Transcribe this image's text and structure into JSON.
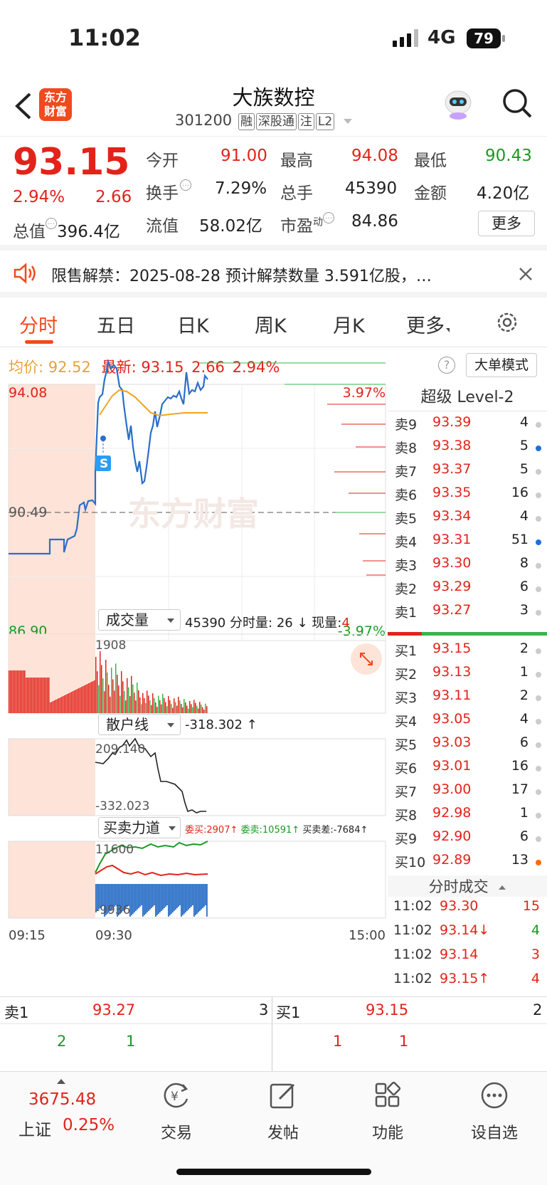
{
  "status": {
    "time": "11:02",
    "network": "4G",
    "battery": "79"
  },
  "header": {
    "logo_line1": "东方",
    "logo_line2": "财富",
    "title": "大族数控",
    "code": "301200",
    "tags": [
      "融",
      "深股通",
      "注",
      "L2"
    ]
  },
  "quote": {
    "price": "93.15",
    "change_pct": "2.94%",
    "change": "2.66",
    "open_label": "今开",
    "open": "91.00",
    "high_label": "最高",
    "high": "94.08",
    "low_label": "最低",
    "low": "90.43",
    "turnover_label": "换手",
    "turnover": "7.29%",
    "volume_label": "总手",
    "volume": "45390",
    "amount_label": "金额",
    "amount": "4.20亿",
    "mcap_label": "总值",
    "mcap": "396.4亿",
    "float_label": "流值",
    "float": "58.02亿",
    "pe_label": "市盈",
    "pe_super": "动",
    "pe": "84.86",
    "more": "更多"
  },
  "notice": {
    "text": "限售解禁：2025-08-28 预计解禁数量 3.591亿股，…"
  },
  "tabs": [
    {
      "label": "分时"
    },
    {
      "label": "五日"
    },
    {
      "label": "日K"
    },
    {
      "label": "周K"
    },
    {
      "label": "月K"
    },
    {
      "label": "更多"
    }
  ],
  "intraday": {
    "avg_label": "均价:",
    "avg": "92.52",
    "last_label": "最新:",
    "last": "93.15",
    "chg": "2.66",
    "pct": "2.94%",
    "mode_button": "大单模式",
    "y_max": "94.08",
    "y_mid": "90.49",
    "y_min": "86.90",
    "pct_max": "3.97%",
    "pct_min": "-3.97%",
    "s_marker": "S",
    "watermark": "东方财富"
  },
  "volume": {
    "label": "成交量",
    "total": "45390",
    "minute_label": "分时量:",
    "minute": "26",
    "minute_arrow": "↓",
    "now_label": "现量:",
    "now": "4",
    "ymax": "1908"
  },
  "retail": {
    "label": "散户线",
    "value": "-318.302",
    "arrow": "↑",
    "ymax": "209.140",
    "ymin": "-332.023"
  },
  "power": {
    "label": "买卖力道",
    "buy_label": "委买:2907",
    "buy_arrow": "↑",
    "sell_label": "委卖:10591",
    "sell_arrow": "↑",
    "diff_label": "买卖差:-7684",
    "diff_arrow": "↑",
    "ymax": "11600",
    "ymin": "-9936"
  },
  "time_axis": [
    "09:15",
    "09:30",
    "15:00"
  ],
  "book": {
    "title": "超级 Level-2",
    "asks": [
      {
        "l": "卖9",
        "p": "93.39",
        "v": "4",
        "dot": "#ccc"
      },
      {
        "l": "卖8",
        "p": "93.38",
        "v": "5",
        "dot": "#1f6fd6"
      },
      {
        "l": "卖7",
        "p": "93.37",
        "v": "5",
        "dot": "#ccc"
      },
      {
        "l": "卖6",
        "p": "93.35",
        "v": "16",
        "dot": "#ccc"
      },
      {
        "l": "卖5",
        "p": "93.34",
        "v": "4",
        "dot": "#ccc"
      },
      {
        "l": "卖4",
        "p": "93.31",
        "v": "51",
        "dot": "#1f6fd6"
      },
      {
        "l": "卖3",
        "p": "93.30",
        "v": "8",
        "dot": "#ccc"
      },
      {
        "l": "卖2",
        "p": "93.29",
        "v": "6",
        "dot": "#ccc"
      },
      {
        "l": "卖1",
        "p": "93.27",
        "v": "3",
        "dot": "#ccc"
      }
    ],
    "bids": [
      {
        "l": "买1",
        "p": "93.15",
        "v": "2",
        "dot": "#ccc"
      },
      {
        "l": "买2",
        "p": "93.13",
        "v": "1",
        "dot": "#ccc"
      },
      {
        "l": "买3",
        "p": "93.11",
        "v": "2",
        "dot": "#ccc"
      },
      {
        "l": "买4",
        "p": "93.05",
        "v": "4",
        "dot": "#ccc"
      },
      {
        "l": "买5",
        "p": "93.03",
        "v": "6",
        "dot": "#ccc"
      },
      {
        "l": "买6",
        "p": "93.01",
        "v": "16",
        "dot": "#ccc"
      },
      {
        "l": "买7",
        "p": "93.00",
        "v": "17",
        "dot": "#ccc"
      },
      {
        "l": "买8",
        "p": "92.98",
        "v": "1",
        "dot": "#ccc"
      },
      {
        "l": "买9",
        "p": "92.90",
        "v": "6",
        "dot": "#ccc"
      },
      {
        "l": "买10",
        "p": "92.89",
        "v": "13",
        "dot": "#ff6a00"
      }
    ],
    "ticks_title": "分时成交",
    "ticks": [
      {
        "t": "11:02",
        "p": "93.30",
        "v": "15",
        "color": "#e2231a",
        "vcolor": "#e2231a"
      },
      {
        "t": "11:02",
        "p": "93.14↓",
        "v": "4",
        "color": "#e2231a",
        "vcolor": "#1a9a23"
      },
      {
        "t": "11:02",
        "p": "93.14",
        "v": "3",
        "color": "#e2231a",
        "vcolor": "#e2231a"
      },
      {
        "t": "11:02",
        "p": "93.15↑",
        "v": "4",
        "color": "#e2231a",
        "vcolor": "#e2231a"
      }
    ]
  },
  "l2row": {
    "sell_label": "卖1",
    "sell_price": "93.27",
    "sell_total": "3",
    "sell_q": [
      "2",
      "1"
    ],
    "buy_label": "买1",
    "buy_price": "93.15",
    "buy_total": "2",
    "buy_q": [
      "1",
      "1"
    ]
  },
  "bottom": {
    "index_value": "3675.48",
    "index_name": "上证",
    "index_pct": "0.25%",
    "items": [
      "交易",
      "发帖",
      "功能",
      "设自选"
    ]
  }
}
